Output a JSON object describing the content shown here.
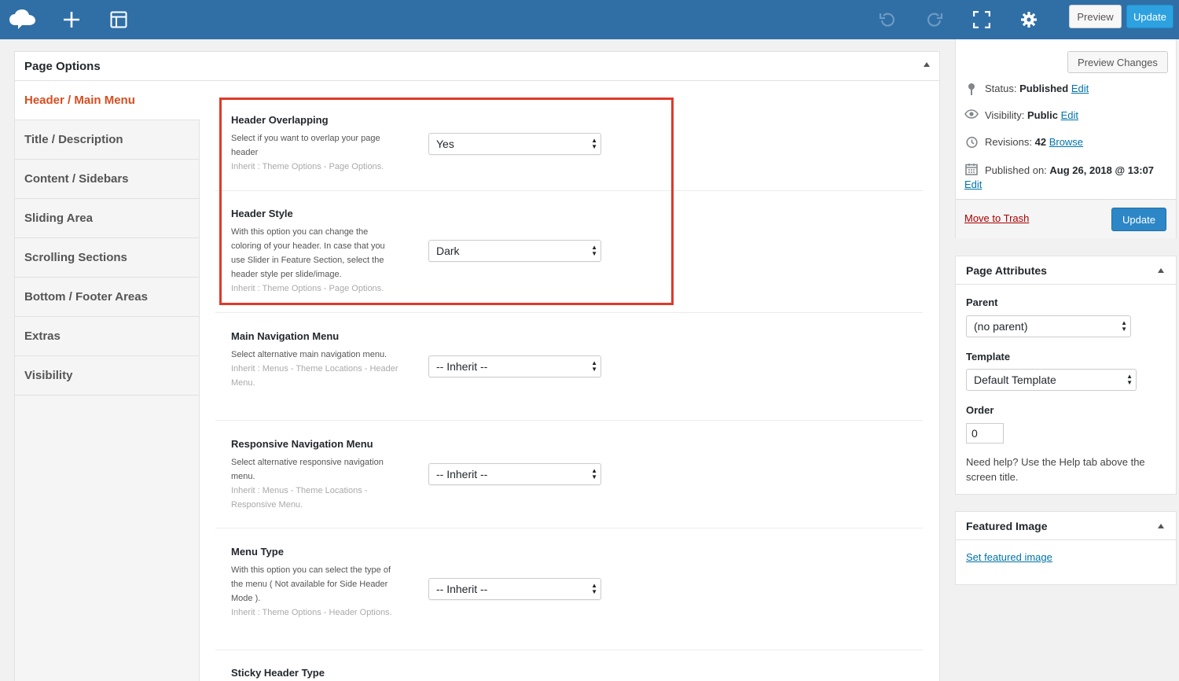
{
  "toolbar": {
    "preview_label": "Preview",
    "update_label": "Update",
    "icons": [
      "logo-cloud-icon",
      "plus-icon",
      "layout-icon",
      "undo-icon",
      "redo-icon",
      "fullscreen-icon",
      "gear-icon"
    ]
  },
  "panel": {
    "title": "Page Options",
    "tabs": [
      {
        "label": "Header / Main Menu"
      },
      {
        "label": "Title / Description"
      },
      {
        "label": "Content / Sidebars"
      },
      {
        "label": "Sliding Area"
      },
      {
        "label": "Scrolling Sections"
      },
      {
        "label": "Bottom / Footer Areas"
      },
      {
        "label": "Extras"
      },
      {
        "label": "Visibility"
      }
    ],
    "options": [
      {
        "title": "Header Overlapping",
        "desc": "Select if you want to overlap your page header",
        "inherit": "Inherit : Theme Options - Page Options.",
        "value": "Yes"
      },
      {
        "title": "Header Style",
        "desc": "With this option you can change the coloring of your header. In case that you use Slider in Feature Section, select the header style per slide/image.",
        "inherit": "Inherit : Theme Options - Page Options.",
        "value": "Dark"
      },
      {
        "title": "Main Navigation Menu",
        "desc": "Select alternative main navigation menu.",
        "inherit": "Inherit : Menus - Theme Locations - Header Menu.",
        "value": "-- Inherit --"
      },
      {
        "title": "Responsive Navigation Menu",
        "desc": "Select alternative responsive navigation menu.",
        "inherit": "Inherit : Menus - Theme Locations - Responsive Menu.",
        "value": "-- Inherit --"
      },
      {
        "title": "Menu Type",
        "desc": "With this option you can select the type of the menu ( Not available for Side Header Mode ).",
        "inherit": "Inherit : Theme Options - Header Options.",
        "value": "-- Inherit --"
      },
      {
        "title": "Sticky Header Type"
      }
    ]
  },
  "publish": {
    "preview_changes": "Preview Changes",
    "status_label": "Status:",
    "status_value": "Published",
    "visibility_label": "Visibility:",
    "visibility_value": "Public",
    "revisions_label": "Revisions:",
    "revisions_value": "42",
    "browse": "Browse",
    "published_label": "Published on:",
    "published_value": "Aug 26, 2018 @ 13:07",
    "edit": "Edit",
    "trash": "Move to Trash",
    "update": "Update"
  },
  "attributes": {
    "title": "Page Attributes",
    "parent_label": "Parent",
    "parent_value": "(no parent)",
    "template_label": "Template",
    "template_value": "Default Template",
    "order_label": "Order",
    "order_value": "0",
    "help": "Need help? Use the Help tab above the screen title."
  },
  "featured": {
    "title": "Featured Image",
    "link": "Set featured image"
  },
  "colors": {
    "topbar": "#2f6fa6",
    "accent": "#d54e21",
    "highlight": "#e0392a",
    "link": "#0073aa"
  }
}
